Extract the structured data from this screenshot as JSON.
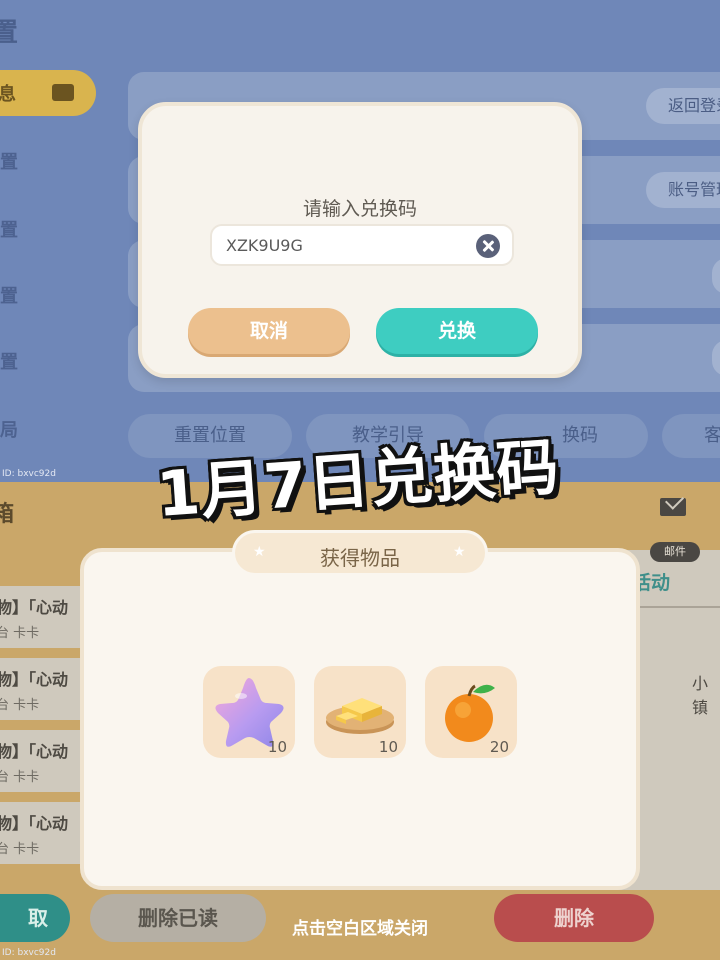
{
  "settings_screen": {
    "title": "置",
    "sidebar": [
      {
        "label": "息",
        "active": true
      },
      {
        "label": "置"
      },
      {
        "label": "置"
      },
      {
        "label": "置"
      },
      {
        "label": "置"
      },
      {
        "label": "局"
      }
    ],
    "row_buttons": [
      "返回登录",
      "账号管理"
    ],
    "bottom_pills": [
      "重置位置",
      "教学引导",
      "换码",
      "客"
    ],
    "id_label": "ID: bxvc92d"
  },
  "mail_screen": {
    "title": "箱",
    "mail_items": [
      {
        "title": "物】「心动",
        "sender": "台 卡卡"
      },
      {
        "title": "物】「心动",
        "sender": "台 卡卡"
      },
      {
        "title": "物】「心动",
        "sender": "台 卡卡"
      },
      {
        "title": "物】「心动",
        "sender": "台 卡卡"
      }
    ],
    "mail_badge": "邮件",
    "event_tab": "活动",
    "event_name": "小镇",
    "claim_label": "取",
    "delete_read_label": "删除已读",
    "delete_label": "删除",
    "id_label": "ID: bxvc92d"
  },
  "redeem_dialog": {
    "title": "请输入兑换码",
    "code_value": "XZK9U9G",
    "cancel_label": "取消",
    "redeem_label": "兑换"
  },
  "overlay_title": "1月7日兑换码",
  "reward_popup": {
    "title": "获得物品",
    "items": [
      {
        "icon": "star-icon",
        "qty": "10"
      },
      {
        "icon": "butter-icon",
        "qty": "10"
      },
      {
        "icon": "orange-icon",
        "qty": "20"
      }
    ],
    "close_hint": "点击空白区域关闭"
  },
  "colors": {
    "teal": "#3ecdc1",
    "cancel_orange": "#ecc08e",
    "delete_red": "#b94d4d",
    "dialog_bg": "#f7f3ec"
  }
}
